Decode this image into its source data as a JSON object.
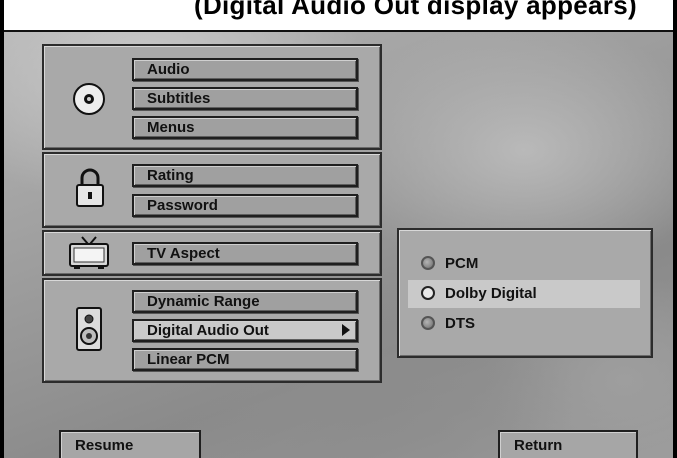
{
  "header": {
    "caption": "(Digital Audio Out display appears)"
  },
  "menu": {
    "groups": [
      {
        "icon": "disc-icon",
        "items": [
          "Audio",
          "Subtitles",
          "Menus"
        ]
      },
      {
        "icon": "lock-icon",
        "items": [
          "Rating",
          "Password"
        ]
      },
      {
        "icon": "tv-icon",
        "items": [
          "TV Aspect"
        ]
      },
      {
        "icon": "speaker-icon",
        "items": [
          "Dynamic Range",
          "Digital Audio Out",
          "Linear PCM"
        ]
      }
    ],
    "submenu_item": "Digital Audio Out"
  },
  "submenu": {
    "options": [
      {
        "label": "PCM",
        "state": "dim"
      },
      {
        "label": "Dolby Digital",
        "state": "selected"
      },
      {
        "label": "DTS",
        "state": "dim"
      }
    ]
  },
  "footer": {
    "resume_label": "Resume",
    "return_label": "Return"
  }
}
